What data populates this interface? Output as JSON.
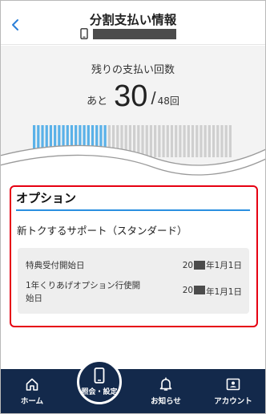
{
  "header": {
    "title": "分割支払い情報",
    "back_icon": "chevron-left-icon",
    "phone_icon": "smartphone-icon"
  },
  "installments": {
    "label": "残りの支払い回数",
    "prefix": "あと",
    "remaining": "30",
    "slash": "/",
    "total": "48回",
    "remaining_value": 30,
    "total_value": 48
  },
  "options": {
    "title": "オプション",
    "plan_name": "新トクするサポート（スタンダード）",
    "rows": [
      {
        "label": "特典受付開始日",
        "value_prefix": "20",
        "value_suffix": "年1月1日"
      },
      {
        "label_line1": "1年くりあげオプション行使開",
        "label_line2": "始日",
        "value_prefix": "20",
        "value_suffix": "年1月1日"
      }
    ]
  },
  "nav": {
    "items": [
      {
        "label": "ホーム",
        "icon": "home-icon"
      },
      {
        "label": "照会・設定",
        "icon": "smartphone-icon"
      },
      {
        "label": "お知らせ",
        "icon": "bell-icon"
      },
      {
        "label": "アカウント",
        "icon": "account-card-icon"
      }
    ]
  },
  "colors": {
    "accent_blue": "#2b8fe0",
    "bar_paid": "#5ab1e8",
    "bar_remaining": "#cfcfcf",
    "highlight_red": "#e60012",
    "nav_bg": "#13294b"
  }
}
